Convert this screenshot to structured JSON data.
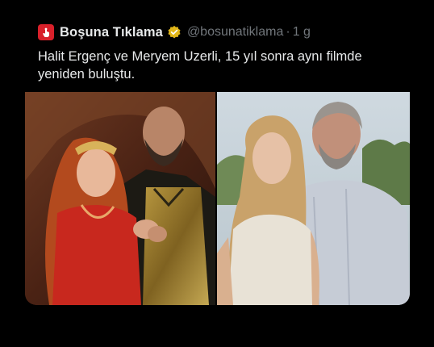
{
  "tweet": {
    "display_name": "Boşuna Tıklama",
    "handle": "@bosunatiklama",
    "separator": "·",
    "time": "1 g",
    "text_line1": "Halit Ergenç ve Meryem Uzerli, 15 yıl sonra aynı filmde",
    "text_line2": "yeniden buluştu."
  },
  "icons": {
    "avatar": "cursor-hand-icon",
    "verified": "gold-verified-badge-icon"
  },
  "colors": {
    "background": "#000000",
    "text": "#e7e9ea",
    "muted": "#71767b",
    "avatar_red": "#d8202a",
    "badge_gold": "#e2b719"
  }
}
